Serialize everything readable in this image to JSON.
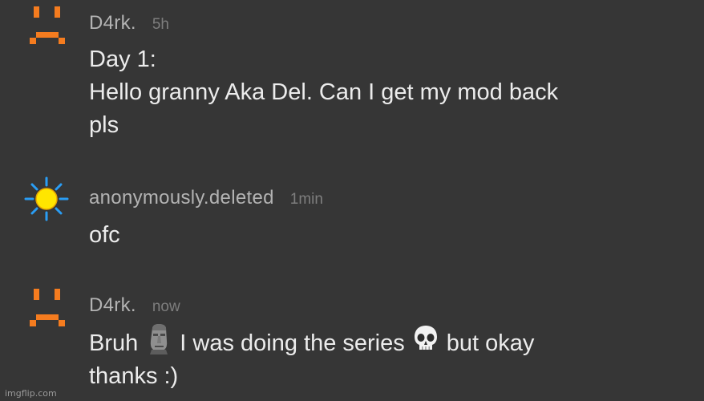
{
  "comments": [
    {
      "username": "D4rk.",
      "time": "5h",
      "avatar_icon": "sad-face-orange-pixel-icon",
      "lines": [
        "Day 1:",
        "Hello granny Aka Del. Can I get my mod back",
        "pls"
      ]
    },
    {
      "username": "anonymously.deleted",
      "time": "1min",
      "avatar_icon": "sun-yellow-icon",
      "lines": [
        "ofc"
      ]
    },
    {
      "username": "D4rk.",
      "time": "now",
      "avatar_icon": "sad-face-orange-pixel-icon",
      "line1_a": "Bruh",
      "line1_b": "I was doing the series",
      "line1_c": "but okay",
      "line2": "thanks :)",
      "emoji_1": "moai-emoji",
      "emoji_2": "skull-emoji"
    }
  ],
  "watermark": "imgflip.com",
  "colors": {
    "background": "#363636",
    "username": "#b3b3b3",
    "time": "#7e7e7e",
    "text": "#ececec",
    "avatar_orange": "#f57c1f",
    "sun_yellow": "#ffe600",
    "sun_rays": "#2a9df4"
  }
}
